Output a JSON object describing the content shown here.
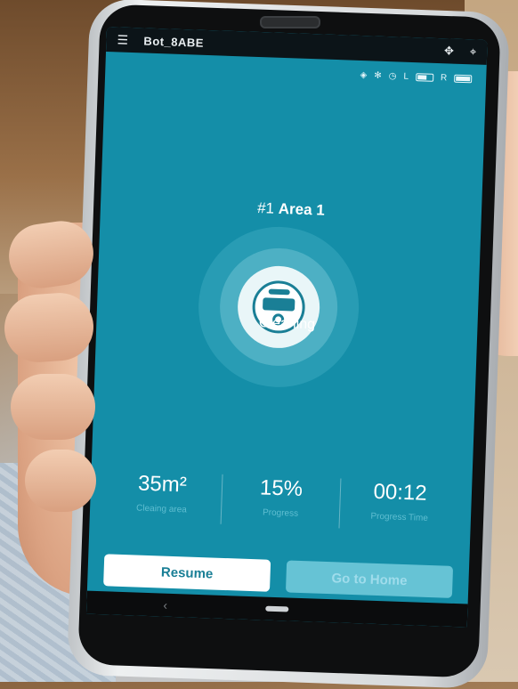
{
  "app": {
    "title": "Bot_8ABE"
  },
  "status_bar": {
    "l_label": "L",
    "r_label": "R",
    "l_fill": 0.6,
    "r_fill": 1.0
  },
  "robot": {
    "area_number": "#1",
    "area_name": "Area 1",
    "state": "Cleaning"
  },
  "stats": [
    {
      "value": "35m²",
      "label": "Cleaing area"
    },
    {
      "value": "15%",
      "label": "Progress"
    },
    {
      "value": "00:12",
      "label": "Progress Time"
    }
  ],
  "buttons": {
    "resume": "Resume",
    "go_home": "Go to Home"
  },
  "icons": {
    "menu": "menu-icon",
    "move": "move-icon",
    "location": "location-icon",
    "target": "target-icon",
    "fan": "fan-icon",
    "timer": "timer-icon"
  },
  "colors": {
    "screen": "#148ea8",
    "accent": "#1a7f96",
    "disabled": "#66c3d5"
  }
}
